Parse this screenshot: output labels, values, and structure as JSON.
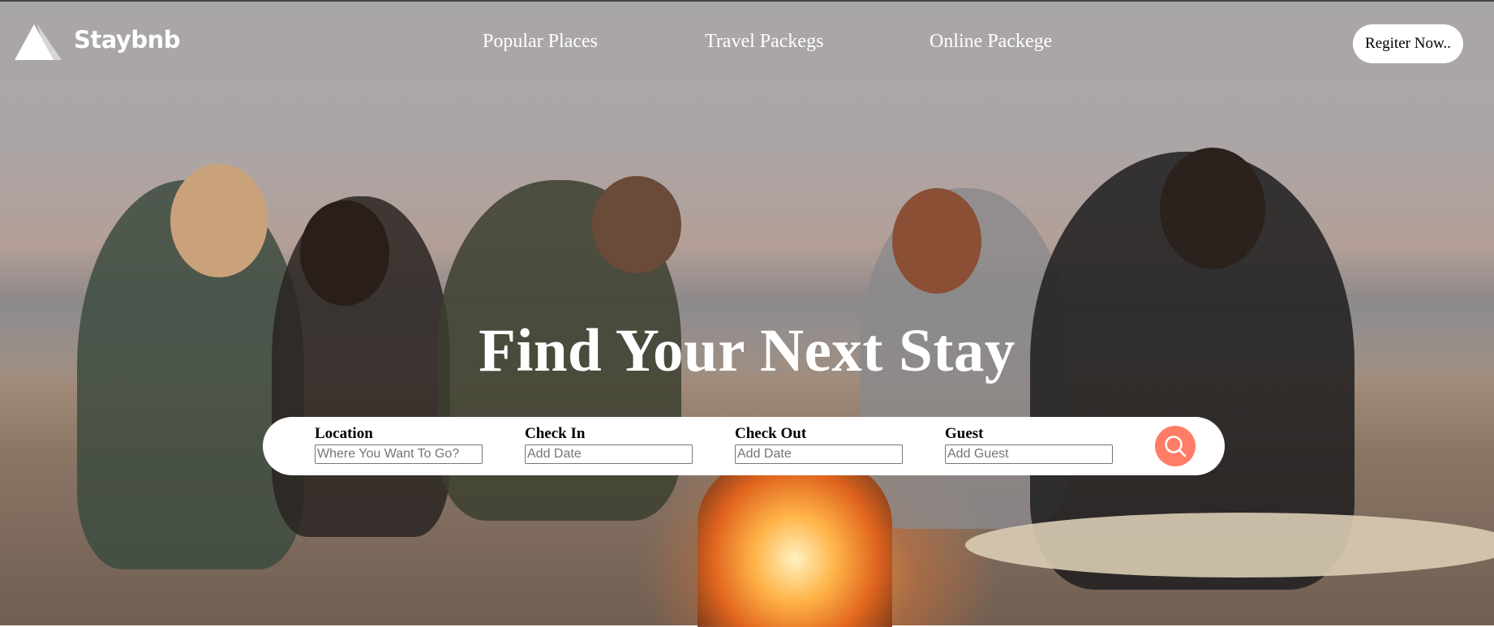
{
  "brand": {
    "name": "Staybnb",
    "logo_icon": "triangle-logo-icon"
  },
  "nav": {
    "links": [
      "Popular Places",
      "Travel Packegs",
      "Online Packege"
    ],
    "register_label": "Regiter Now.."
  },
  "hero": {
    "headline": "Find Your Next Stay",
    "background": "photo of friends around a beach campfire at sunset"
  },
  "search": {
    "fields": [
      {
        "label": "Location",
        "placeholder": "Where You Want To Go?",
        "value": ""
      },
      {
        "label": "Check In",
        "placeholder": "Add Date",
        "value": ""
      },
      {
        "label": "Check Out",
        "placeholder": "Add Date",
        "value": ""
      },
      {
        "label": "Guest",
        "placeholder": "Add Guest",
        "value": ""
      }
    ],
    "button_icon": "search-icon"
  },
  "colors": {
    "accent": "#ff7c67",
    "text_on_hero": "#ffffff",
    "search_bar_bg": "#ffffff"
  }
}
